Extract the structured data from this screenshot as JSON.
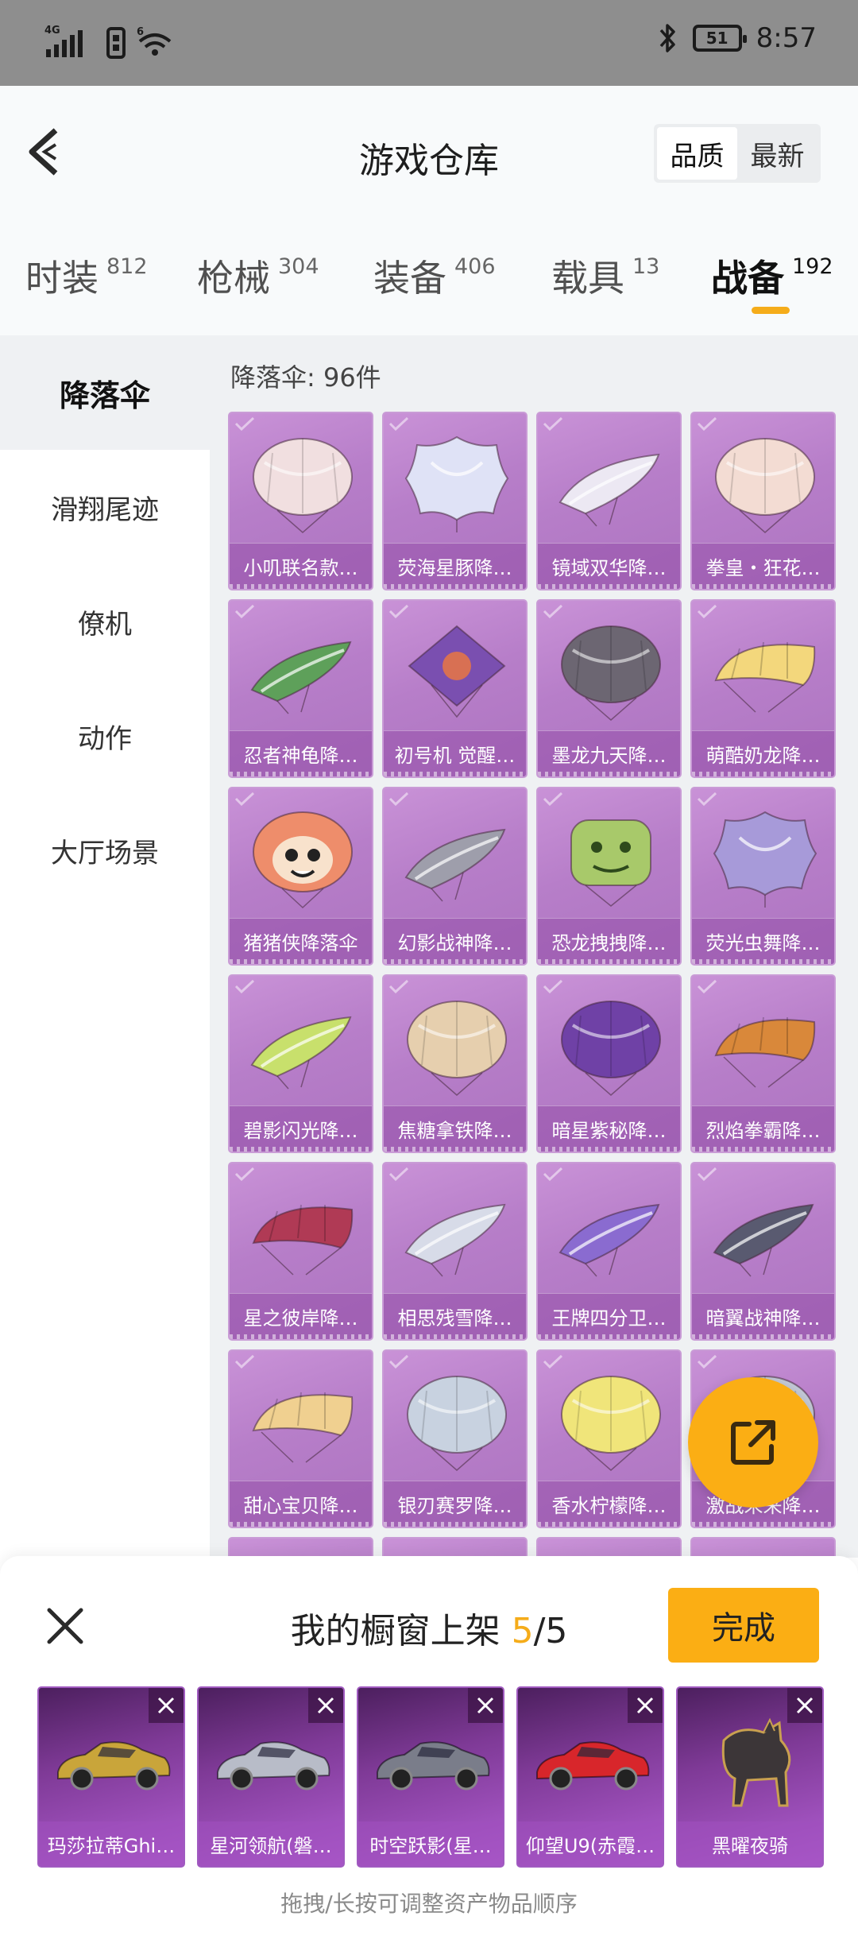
{
  "status_bar": {
    "network": "4G",
    "wifi": "6",
    "battery": "51",
    "time": "8:57"
  },
  "header": {
    "title": "游戏仓库",
    "sort": [
      "品质",
      "最新"
    ],
    "active_sort": "品质"
  },
  "tabs": [
    {
      "label": "时装",
      "count": "812"
    },
    {
      "label": "枪械",
      "count": "304"
    },
    {
      "label": "装备",
      "count": "406"
    },
    {
      "label": "载具",
      "count": "13"
    },
    {
      "label": "战备",
      "count": "192"
    }
  ],
  "sidebar": {
    "items": [
      "降落伞",
      "滑翔尾迹",
      "僚机",
      "动作",
      "大厅场景"
    ]
  },
  "main": {
    "heading": "降落伞: 96件",
    "items": [
      {
        "name": "小叽联名款…",
        "icon": "parachute-round-icon",
        "color": "#f1dfe0"
      },
      {
        "name": "荧海星豚降…",
        "icon": "parachute-star-icon",
        "color": "#dfe2f6"
      },
      {
        "name": "镜域双华降…",
        "icon": "glider-icon",
        "color": "#ece8f3"
      },
      {
        "name": "拳皇・狂花…",
        "icon": "parachute-round-icon",
        "color": "#f3dcd3"
      },
      {
        "name": "忍者神龟降…",
        "icon": "glider-icon",
        "color": "#5ea05a"
      },
      {
        "name": "初号机 觉醒…",
        "icon": "parachute-diamond-icon",
        "color": "#7a4fb0"
      },
      {
        "name": "墨龙九天降…",
        "icon": "parachute-round-icon",
        "color": "#6c6672"
      },
      {
        "name": "萌酷奶龙降…",
        "icon": "parachute-canopy-icon",
        "color": "#f3d77c"
      },
      {
        "name": "猪猪侠降落伞",
        "icon": "parachute-face-icon",
        "color": "#ee8d6b"
      },
      {
        "name": "幻影战神降…",
        "icon": "glider-icon",
        "color": "#9e9eab"
      },
      {
        "name": "恐龙拽拽降…",
        "icon": "parachute-square-icon",
        "color": "#a8c96a"
      },
      {
        "name": "荧光虫舞降…",
        "icon": "parachute-star-icon",
        "color": "#a79ad9"
      },
      {
        "name": "碧影闪光降…",
        "icon": "glider-icon",
        "color": "#c8e06c"
      },
      {
        "name": "焦糖拿铁降…",
        "icon": "parachute-round-icon",
        "color": "#e6cfae"
      },
      {
        "name": "暗星紫秘降…",
        "icon": "parachute-round-icon",
        "color": "#6f41a6"
      },
      {
        "name": "烈焰拳霸降…",
        "icon": "parachute-canopy-icon",
        "color": "#d9883a"
      },
      {
        "name": "星之彼岸降…",
        "icon": "parachute-canopy-icon",
        "color": "#b03a55"
      },
      {
        "name": "相思残雪降…",
        "icon": "glider-icon",
        "color": "#d7dbe8"
      },
      {
        "name": "王牌四分卫…",
        "icon": "glider-icon",
        "color": "#8a6bd0"
      },
      {
        "name": "暗翼战神降…",
        "icon": "glider-icon",
        "color": "#595a70"
      },
      {
        "name": "甜心宝贝降…",
        "icon": "parachute-canopy-icon",
        "color": "#f0d090"
      },
      {
        "name": "银刃赛罗降…",
        "icon": "parachute-round-icon",
        "color": "#c8d2e0"
      },
      {
        "name": "香水柠檬降…",
        "icon": "parachute-round-icon",
        "color": "#f0e57a"
      },
      {
        "name": "激战未来降…",
        "icon": "parachute-round-icon",
        "color": "#c3c9d6"
      }
    ]
  },
  "fab": {
    "icon": "share-external-icon"
  },
  "sheet": {
    "title_prefix": "我的橱窗上架",
    "current": "5",
    "total": "/5",
    "done_label": "完成",
    "items": [
      {
        "name": "玛莎拉蒂Ghi…",
        "icon": "car-icon",
        "color": "#c9a53a"
      },
      {
        "name": "星河领航(磐…",
        "icon": "car-icon",
        "color": "#b8bcc8"
      },
      {
        "name": "时空跃影(星…",
        "icon": "car-icon",
        "color": "#7a7d8a"
      },
      {
        "name": "仰望U9(赤霞…",
        "icon": "car-icon",
        "color": "#d8262b"
      },
      {
        "name": "黑曜夜骑",
        "icon": "horse-icon",
        "color": "#3c3638"
      }
    ],
    "hint": "拖拽/长按可调整资产物品顺序"
  }
}
